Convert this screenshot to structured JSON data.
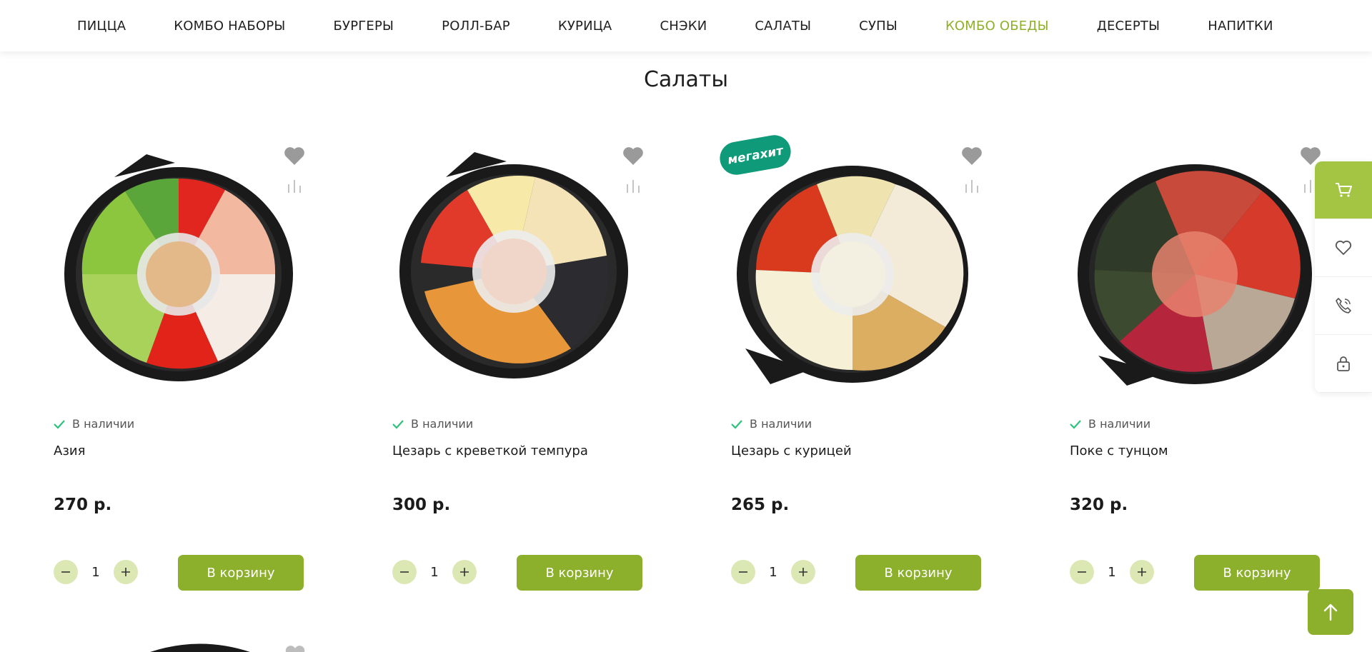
{
  "nav": {
    "items": [
      {
        "label": "ПИЦЦА"
      },
      {
        "label": "КОМБО НАБОРЫ"
      },
      {
        "label": "БУРГЕРЫ"
      },
      {
        "label": "РОЛЛ-БАР"
      },
      {
        "label": "КУРИЦА"
      },
      {
        "label": "СНЭКИ"
      },
      {
        "label": "САЛАТЫ"
      },
      {
        "label": "СУПЫ"
      },
      {
        "label": "КОМБО ОБЕДЫ",
        "active": true
      },
      {
        "label": "ДЕСЕРТЫ"
      },
      {
        "label": "НАПИТКИ"
      }
    ]
  },
  "section": {
    "title": "Салаты"
  },
  "products": [
    {
      "name": "Азия",
      "price": "270 р.",
      "stock": "В наличии",
      "qty": "1",
      "cart_label": "В корзину"
    },
    {
      "name": "Цезарь с креветкой темпура",
      "price": "300 р.",
      "stock": "В наличии",
      "qty": "1",
      "cart_label": "В корзину"
    },
    {
      "name": "Цезарь с курицей",
      "price": "265 р.",
      "stock": "В наличии",
      "qty": "1",
      "cart_label": "В корзину",
      "badge": "мегахит"
    },
    {
      "name": "Поке с тунцом",
      "price": "320 р.",
      "stock": "В наличии",
      "qty": "1",
      "cart_label": "В корзину"
    }
  ],
  "side_panel": {
    "icons": [
      "cart-icon",
      "heart-icon",
      "phone-icon",
      "lock-icon"
    ]
  },
  "colors": {
    "accent": "#8cb02b",
    "nav_active": "#8fb02a",
    "qty_button": "#dce8b4",
    "in_stock": "#2ec27e"
  }
}
